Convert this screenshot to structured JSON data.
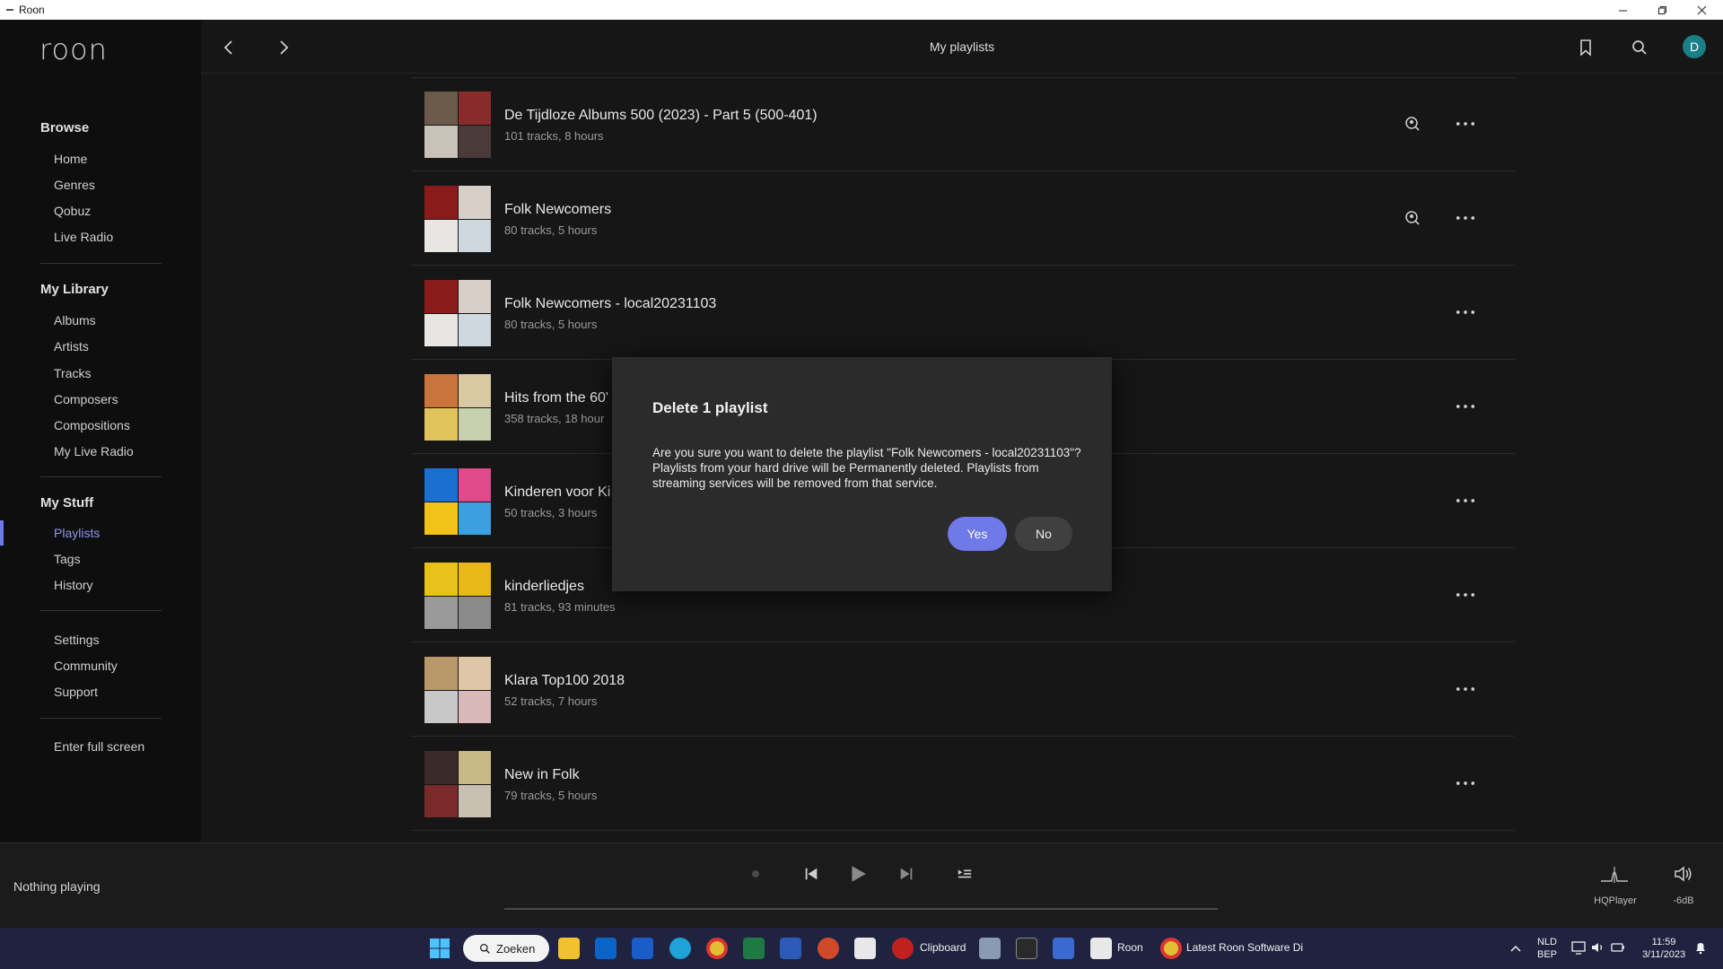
{
  "window": {
    "title": "Roon"
  },
  "sidebar": {
    "logo": "roon",
    "browse_heading": "Browse",
    "browse_items": [
      "Home",
      "Genres",
      "Qobuz",
      "Live Radio"
    ],
    "library_heading": "My Library",
    "library_items": [
      "Albums",
      "Artists",
      "Tracks",
      "Composers",
      "Compositions",
      "My Live Radio"
    ],
    "stuff_heading": "My Stuff",
    "stuff_items": [
      "Playlists",
      "Tags",
      "History"
    ],
    "other_items": [
      "Settings",
      "Community",
      "Support"
    ],
    "fullscreen": "Enter full screen",
    "accent": "#6f79e8"
  },
  "header": {
    "title": "My playlists",
    "avatar_letter": "D",
    "avatar_color": "#1a7f86"
  },
  "playlists": [
    {
      "name": "De Tijdloze Albums 500 (2023) - Part 5  (500-401)",
      "meta": "101 tracks, 8 hours",
      "has_search": true,
      "colors": [
        "#6b5a4a",
        "#8a2b2b",
        "#c9c2b8",
        "#4a3a3a"
      ]
    },
    {
      "name": "Folk Newcomers",
      "meta": "80 tracks, 5 hours",
      "has_search": true,
      "colors": [
        "#8b1a1a",
        "#d8d0c8",
        "#e8e6e2",
        "#cfd8de"
      ]
    },
    {
      "name": "Folk Newcomers - local20231103",
      "meta": "80 tracks, 5 hours",
      "has_search": false,
      "colors": [
        "#8b1a1a",
        "#d8d0c8",
        "#e8e6e2",
        "#cfd8de"
      ]
    },
    {
      "name": "Hits from the 60'",
      "meta": "358 tracks, 18 hour",
      "has_search": false,
      "colors": [
        "#c8743a",
        "#d8c9a2",
        "#e0c35a",
        "#c8d0b0"
      ]
    },
    {
      "name": "Kinderen voor Ki",
      "meta": "50 tracks, 3 hours",
      "has_search": false,
      "colors": [
        "#1a6fd0",
        "#e04a8a",
        "#f2c21a",
        "#3aa0e0"
      ]
    },
    {
      "name": "kinderliedjes",
      "meta": "81 tracks, 93 minutes",
      "has_search": false,
      "colors": [
        "#e8c21a",
        "#e8b81a",
        "#9a9a9a",
        "#8a8a8a"
      ]
    },
    {
      "name": "Klara Top100 2018",
      "meta": "52 tracks, 7 hours",
      "has_search": false,
      "colors": [
        "#b89a6a",
        "#e0c6a8",
        "#c8c8c8",
        "#d8b8b8"
      ]
    },
    {
      "name": "New in Folk",
      "meta": "79 tracks, 5 hours",
      "has_search": false,
      "colors": [
        "#3a2a2a",
        "#c8b888",
        "#7a2a2a",
        "#c8c0b0"
      ]
    }
  ],
  "dialog": {
    "title": "Delete 1 playlist",
    "body": "Are you sure you want to delete the playlist \"Folk Newcomers - local20231103\"? Playlists from your hard drive will be Permanently deleted. Playlists from streaming services will be removed from that service.",
    "yes": "Yes",
    "no": "No"
  },
  "player": {
    "now_playing": "Nothing playing",
    "zone": "HQPlayer",
    "volume": "-6dB"
  },
  "taskbar": {
    "search": "Zoeken",
    "clipboard": "Clipboard",
    "roon": "Roon",
    "chrome": "Latest Roon Software Di",
    "lang": "NLD",
    "region": "BEP",
    "time": "11:59",
    "date": "3/11/2023"
  }
}
